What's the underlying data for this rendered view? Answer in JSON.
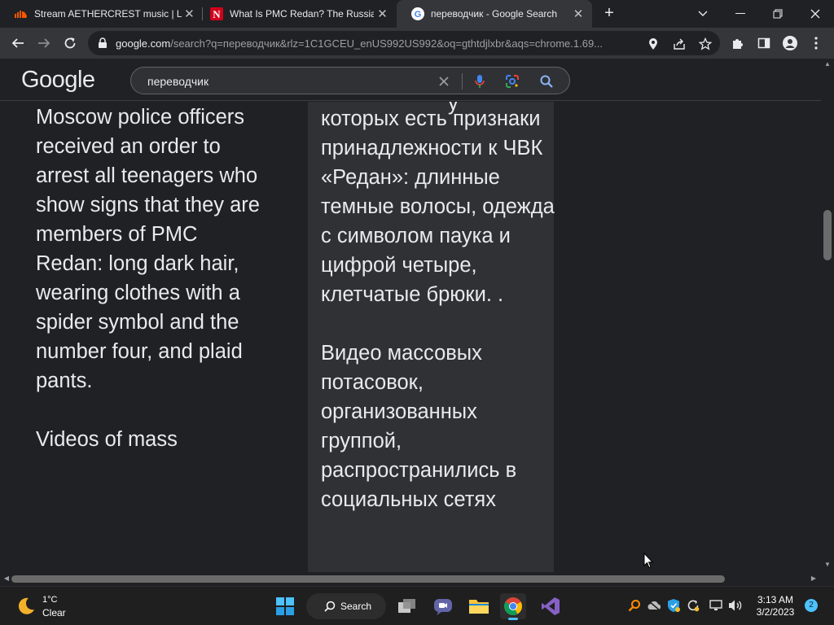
{
  "browser": {
    "tabs": [
      {
        "title": "Stream AETHERCREST music | Listen",
        "favicon": "soundcloud-icon",
        "active": false
      },
      {
        "title": "What Is PMC Redan? The Russian",
        "favicon": "n-logo-icon",
        "active": false
      },
      {
        "title": "переводчик - Google Search",
        "favicon": "google-g-icon",
        "active": true
      }
    ],
    "url_host": "google.com",
    "url_path": "/search?q=переводчик&rlz=1C1GCEU_enUS992US992&oq=gthtdjlxbr&aqs=chrome.1.69..."
  },
  "google": {
    "logo": "Google",
    "query": "переводчик"
  },
  "content": {
    "english_paragraphs": [
      "Moscow police officers received an order to arrest all teenagers who show signs that they are members of PMC Redan: long dark hair, wearing clothes with a spider symbol and the number four, and plaid pants.",
      "Videos of mass"
    ],
    "russian_top_cut": "у",
    "russian_paragraphs": [
      "которых есть признаки принадлежности к ЧВК «Редан»: длинные темные волосы, одежда с символом паука и цифрой четыре, клетчатые брюки. .",
      "Видео массовых потасовок, организованных группой, распространились в социальных сетях"
    ]
  },
  "taskbar": {
    "weather_temp": "1°C",
    "weather_cond": "Clear",
    "search_label": "Search",
    "clock_time": "3:13 AM",
    "clock_date": "3/2/2023",
    "notifications": "2"
  },
  "colors": {
    "accent_blue": "#8ab4f8",
    "soundcloud": "#ff5500",
    "n_logo": "#d0021b"
  }
}
